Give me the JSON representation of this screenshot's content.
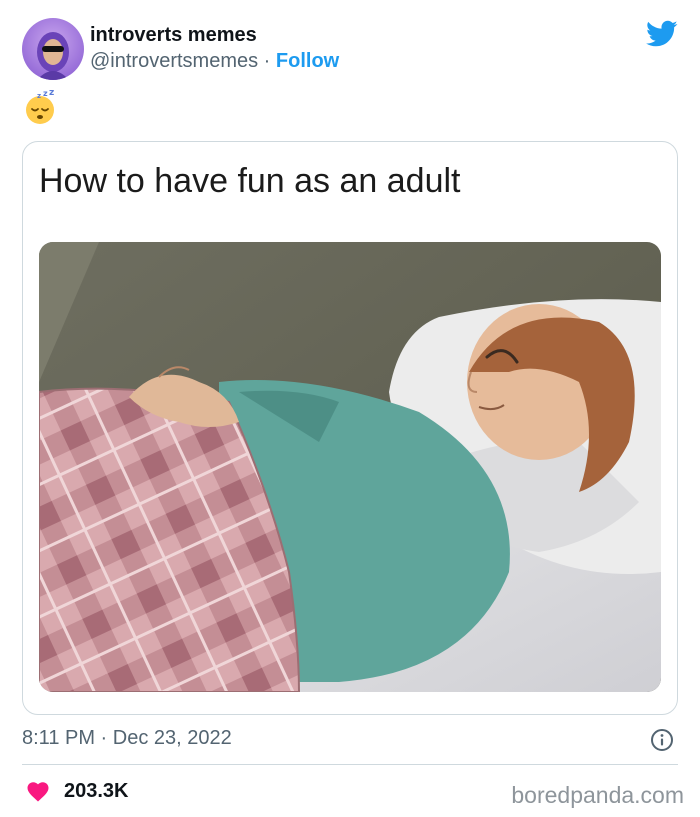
{
  "author": {
    "display_name": "introverts memes",
    "handle": "@introvertsmemes",
    "separator": " · ",
    "follow_label": "Follow"
  },
  "tweet": {
    "emoji": "sleeping-face-emoji",
    "meme_caption": "How to have fun as an adult"
  },
  "meta": {
    "time": "8:11 PM",
    "separator": " · ",
    "date": "Dec 23, 2022"
  },
  "engagement": {
    "likes": "203.3K"
  },
  "watermark": "boredpanda.com",
  "colors": {
    "accent": "#1d9bf0",
    "heart": "#f91880",
    "muted": "#536471",
    "border": "#cfd9de"
  },
  "icons": {
    "brand": "twitter-bird-icon",
    "info": "info-icon",
    "like": "heart-icon"
  }
}
